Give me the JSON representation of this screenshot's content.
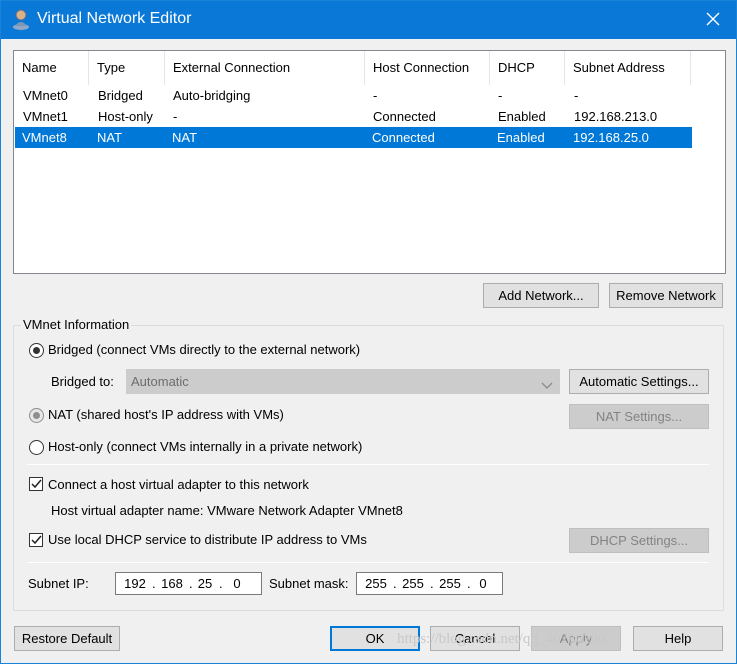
{
  "window": {
    "title": "Virtual Network Editor",
    "title_icon": "vmware-network-icon",
    "close_icon": "close-icon",
    "accent": "#0078d7"
  },
  "network_list": {
    "columns": [
      "Name",
      "Type",
      "External Connection",
      "Host Connection",
      "DHCP",
      "Subnet Address"
    ],
    "rows": [
      {
        "name": "VMnet0",
        "type": "Bridged",
        "external": "Auto-bridging",
        "host": "-",
        "dhcp": "-",
        "subnet": "-",
        "selected": false
      },
      {
        "name": "VMnet1",
        "type": "Host-only",
        "external": "-",
        "host": "Connected",
        "dhcp": "Enabled",
        "subnet": "192.168.213.0",
        "selected": false
      },
      {
        "name": "VMnet8",
        "type": "NAT",
        "external": "NAT",
        "host": "Connected",
        "dhcp": "Enabled",
        "subnet": "192.168.25.0",
        "selected": true
      }
    ]
  },
  "list_buttons": {
    "add": "Add Network...",
    "remove": "Remove Network"
  },
  "vmnet_info": {
    "group_label": "VMnet Information",
    "bridged_label": "Bridged (connect VMs directly to the external network)",
    "bridged_to_label": "Bridged to:",
    "bridged_to_value": "Automatic",
    "automatic_settings": "Automatic Settings...",
    "nat_label": "NAT (shared host's IP address with VMs)",
    "nat_settings": "NAT Settings...",
    "hostonly_label": "Host-only (connect VMs internally in a private network)",
    "connect_adapter_label": "Connect a host virtual adapter to this network",
    "connect_adapter_checked": true,
    "adapter_name_label": "Host virtual adapter name: VMware Network Adapter VMnet8",
    "dhcp_label": "Use local DHCP service to distribute IP address to VMs",
    "dhcp_checked": true,
    "dhcp_settings": "DHCP Settings...",
    "subnet_ip_label": "Subnet IP:",
    "subnet_ip": [
      "192",
      "168",
      "25",
      "0"
    ],
    "subnet_mask_label": "Subnet mask:",
    "subnet_mask": [
      "255",
      "255",
      "255",
      "0"
    ]
  },
  "footer": {
    "restore": "Restore Default",
    "ok": "OK",
    "cancel": "Cancel",
    "apply": "Apply",
    "help": "Help"
  },
  "watermark": "https://blog.csdn.net/qq_40780200"
}
